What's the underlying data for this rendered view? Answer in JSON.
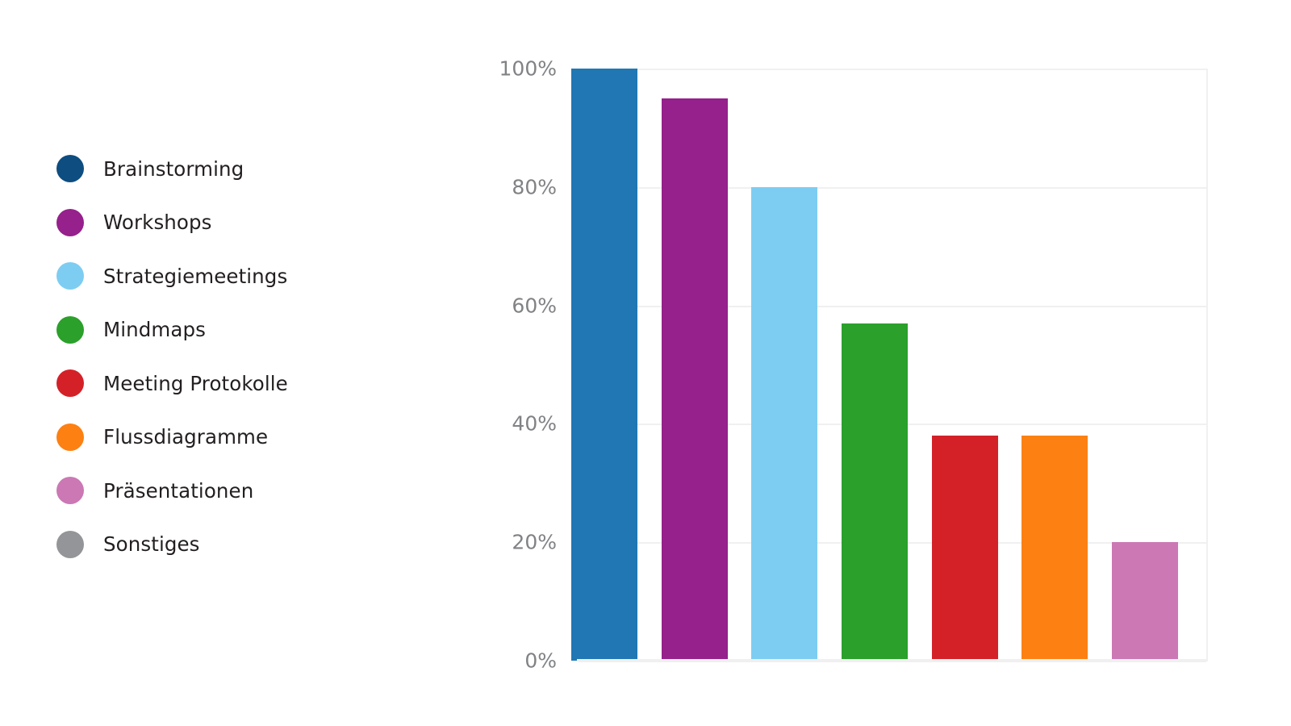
{
  "legend": {
    "position": "left",
    "items": [
      {
        "label": "Brainstorming",
        "color": "#0e4d80"
      },
      {
        "label": "Workshops",
        "color": "#96208c"
      },
      {
        "label": "Strategiemeetings",
        "color": "#7dcdf2"
      },
      {
        "label": "Mindmaps",
        "color": "#2ba02b"
      },
      {
        "label": "Meeting Protokolle",
        "color": "#d42128"
      },
      {
        "label": "Flussdiagramme",
        "color": "#fd8013"
      },
      {
        "label": "Präsentationen",
        "color": "#cb78b4"
      },
      {
        "label": "Sonstiges",
        "color": "#939598"
      }
    ]
  },
  "chart_data": {
    "type": "bar",
    "title": "",
    "subtitle": "",
    "xlabel": "",
    "ylabel": "",
    "categories": [
      "Brainstorming",
      "Workshops",
      "Strategiemeetings",
      "Mindmaps",
      "Meeting Protokolle",
      "Flussdiagramme",
      "Präsentationen"
    ],
    "values": [
      100,
      95,
      80,
      57,
      38,
      38,
      20
    ],
    "value_suffix": "%",
    "colors": [
      "#2077b4",
      "#96208c",
      "#7dcdf2",
      "#2ba02b",
      "#d42128",
      "#fd8013",
      "#cb78b4"
    ],
    "ylim": [
      0,
      100
    ],
    "yticks": [
      0,
      20,
      40,
      60,
      80,
      100
    ],
    "ytick_labels": [
      "0%",
      "20%",
      "40%",
      "60%",
      "80%",
      "100%"
    ],
    "grid": true,
    "grid_color": "#f0f0f0",
    "grid_axis": "y",
    "xtick_labels": [],
    "legend_position": "left",
    "background": "#ffffff",
    "tick_label_color": "#808285"
  }
}
